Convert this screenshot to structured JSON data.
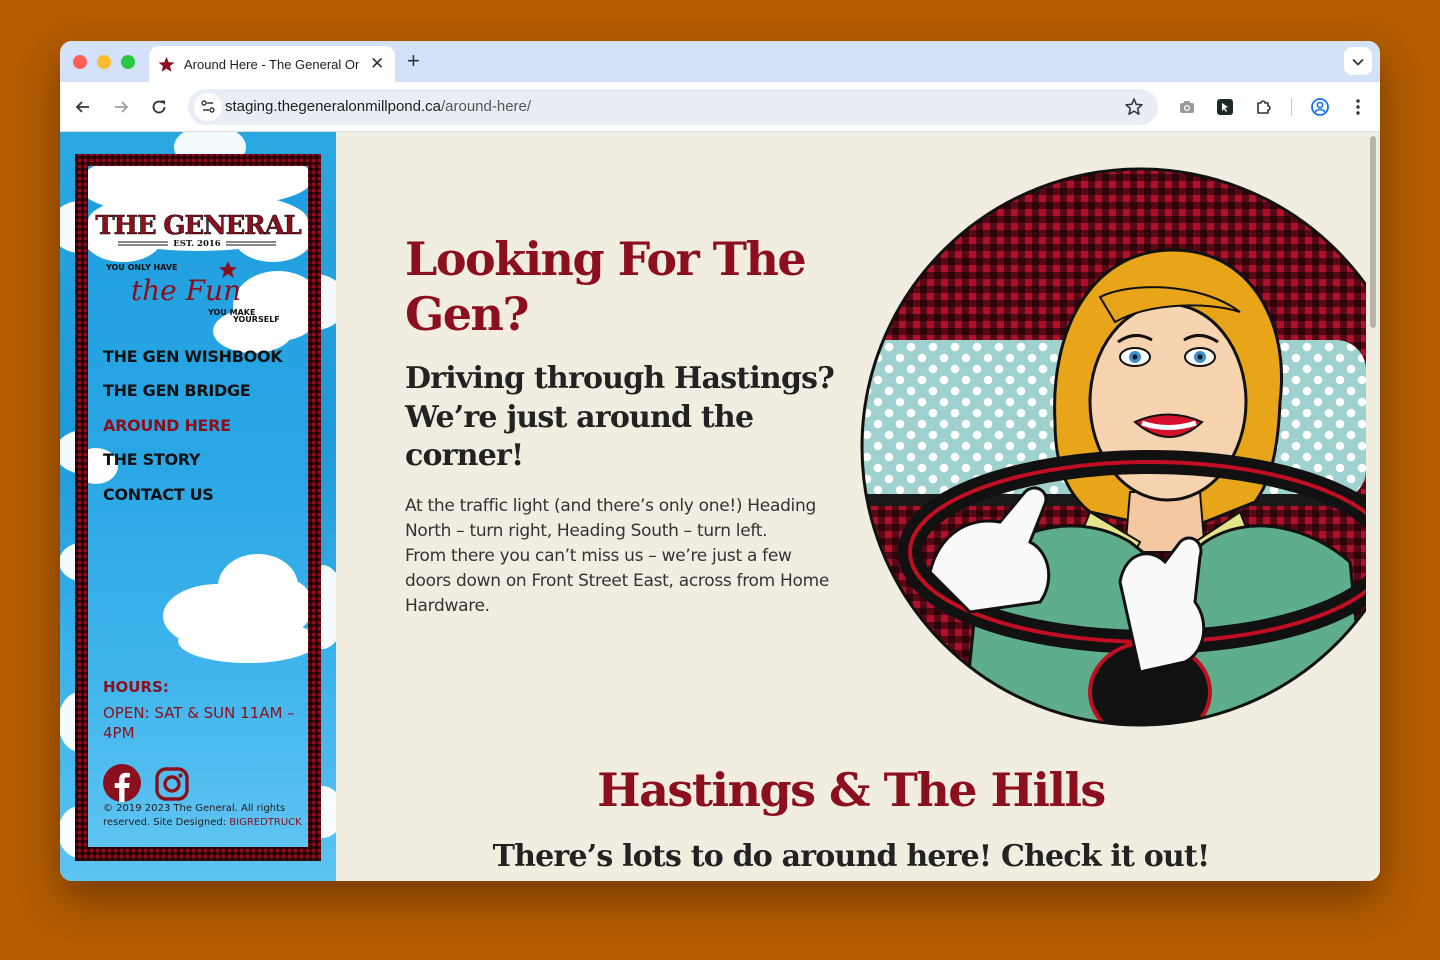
{
  "browser": {
    "tab_title": "Around Here - The General On Millpond",
    "url_domain": "staging.thegeneralonmillpond.ca",
    "url_path": "/around-here/"
  },
  "sidebar": {
    "logo": {
      "name": "THE GENERAL",
      "est": "EST. 2016",
      "tagline_top": "YOU ONLY HAVE",
      "tagline_script": "the Fun",
      "tagline_bottom_1": "YOU MAKE",
      "tagline_bottom_2": "YOURSELF"
    },
    "menu": [
      {
        "label": "THE GEN WISHBOOK"
      },
      {
        "label": "THE GEN BRIDGE"
      },
      {
        "label": "AROUND HERE"
      },
      {
        "label": "THE STORY"
      },
      {
        "label": "CONTACT US"
      }
    ],
    "hours_title": "HOURS:",
    "hours_text": "OPEN: SAT & SUN 11AM – 4PM",
    "copyright": "© 2019 2023 The General. All rights reserved. Site Designed:",
    "credit": "BIGREDTRUCK"
  },
  "main": {
    "heading": "Looking For The Gen?",
    "subheading": "Driving through Hastings? We’re just around the corner!",
    "para1": "At the traffic light (and there’s only one!) Heading North – turn right, Heading South – turn left.",
    "para2": "From there you can’t miss us – we’re just a few doors down on Front Street East, across from Home Hardware.",
    "section_heading": "Hastings & The Hills",
    "section_sub": "There’s lots to do around here! Check it out!"
  },
  "colors": {
    "brand_red": "#8b0f1d",
    "page_bg": "#f2ede1",
    "sky_blue": "#29a8e0"
  }
}
